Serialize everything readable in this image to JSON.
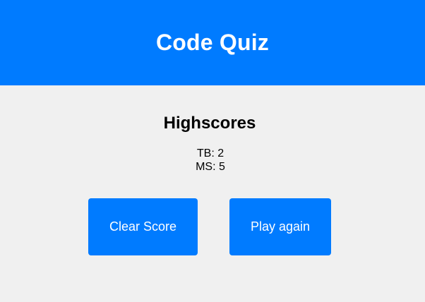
{
  "header": {
    "title": "Code Quiz"
  },
  "highscores": {
    "title": "Highscores",
    "entries": [
      "TB: 2",
      "MS: 5"
    ]
  },
  "buttons": {
    "clear_label": "Clear Score",
    "play_label": "Play again"
  },
  "colors": {
    "primary": "#007bff",
    "background": "#f0f0f0",
    "button_text": "#ffffff"
  }
}
